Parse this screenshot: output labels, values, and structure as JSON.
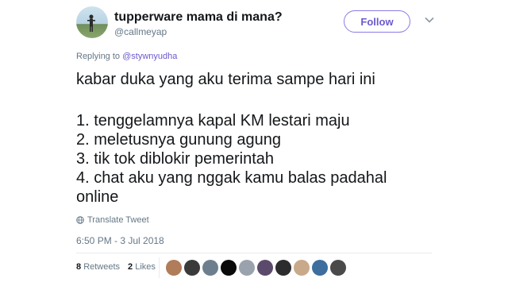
{
  "user": {
    "display_name": "tupperware mama di mana?",
    "username": "@callmeyap"
  },
  "follow_label": "Follow",
  "reply": {
    "prefix": "Replying to",
    "handle": "@stywnyudha"
  },
  "tweet_lines": [
    "kabar duka yang aku terima sampe hari ini",
    "",
    "1. tenggelamnya kapal KM lestari maju",
    "2. meletusnya gunung agung",
    "3. tik tok diblokir pemerintah",
    "4. chat aku yang nggak kamu balas padahal",
    "online"
  ],
  "translate_label": "Translate Tweet",
  "timestamp": "6:50 PM - 3 Jul 2018",
  "stats": {
    "retweets_count": "8",
    "retweets_label": "Retweets",
    "likes_count": "2",
    "likes_label": "Likes"
  },
  "liker_avatar_colors": [
    "#b07c5a",
    "#3a3a3a",
    "#6d7f8f",
    "#0a0a0a",
    "#9aa3ad",
    "#5b4a6b",
    "#2c2c2c",
    "#c8a98a",
    "#3d6e9e",
    "#4a4a4a"
  ],
  "colors": {
    "accent": "#6a5acd",
    "secondary_text": "#657786",
    "text": "#14171a"
  }
}
